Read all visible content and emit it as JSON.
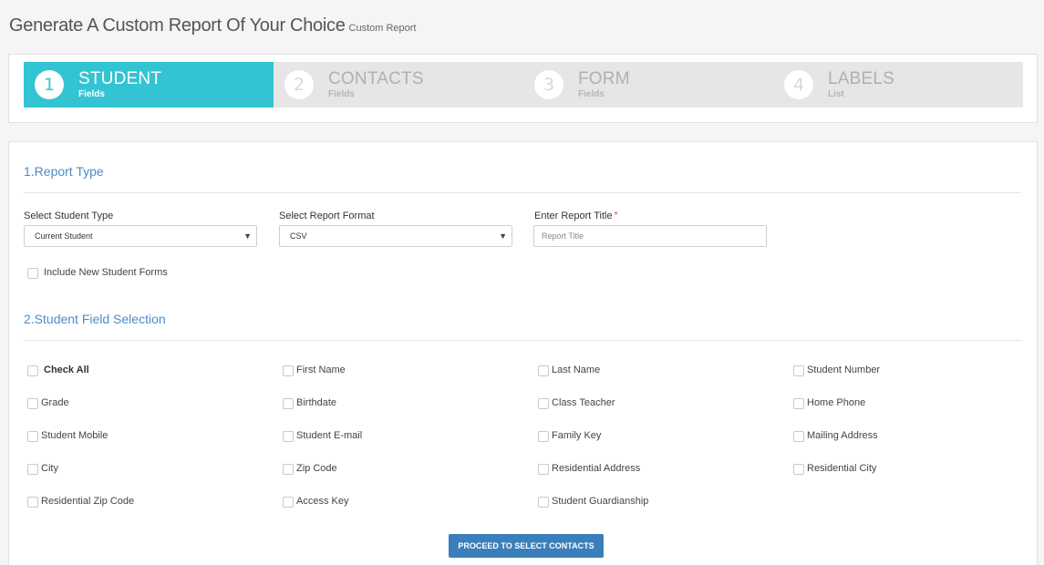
{
  "header": {
    "title": "Generate A Custom Report Of Your Choice",
    "subtitle": "Custom Report"
  },
  "steps": [
    {
      "num": "1",
      "name": "STUDENT",
      "desc": "Fields",
      "active": true
    },
    {
      "num": "2",
      "name": "CONTACTS",
      "desc": "Fields",
      "active": false
    },
    {
      "num": "3",
      "name": "FORM",
      "desc": "Fields",
      "active": false
    },
    {
      "num": "4",
      "name": "LABELS",
      "desc": "List",
      "active": false
    }
  ],
  "report_type": {
    "title": "1.Report Type",
    "student_type_label": "Select Student Type",
    "student_type_value": "Current Student",
    "format_label": "Select Report Format",
    "format_value": "CSV",
    "title_label": "Enter Report Title",
    "required_mark": "*",
    "title_placeholder": "Report Title",
    "include_forms_label": "Include New Student Forms",
    "caret": "▼"
  },
  "field_selection": {
    "title": "2.Student Field Selection",
    "check_all": "Check All",
    "fields": [
      "First Name",
      "Last Name",
      "Student Number",
      "Grade",
      "Birthdate",
      "Class Teacher",
      "Home Phone",
      "Student Mobile",
      "Student E-mail",
      "Family Key",
      "Mailing Address",
      "City",
      "Zip Code",
      "Residential Address",
      "Residential City",
      "Residential Zip Code",
      "Access Key",
      "Student Guardianship"
    ]
  },
  "actions": {
    "proceed_label": "PROCEED TO SELECT CONTACTS"
  },
  "colors": {
    "accent": "#33c4d3",
    "section_title": "#4c8bc8",
    "button": "#3b7fba",
    "required": "#e53935"
  }
}
